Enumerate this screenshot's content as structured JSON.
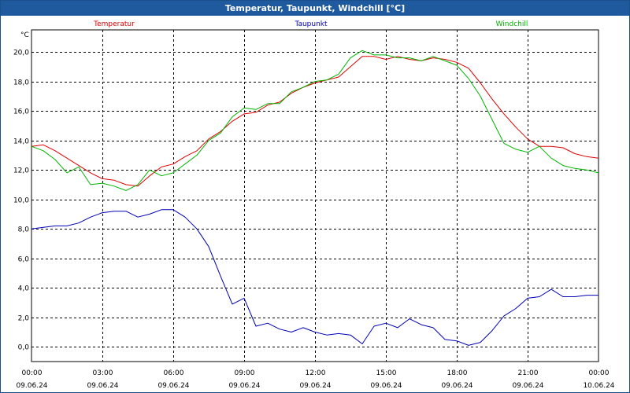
{
  "window": {
    "title": "Temperatur, Taupunkt, Windchill [°C]"
  },
  "chart_data": {
    "type": "line",
    "title": "Temperatur, Taupunkt, Windchill [°C]",
    "ylabel": "°C",
    "ylim": [
      -1,
      21.5
    ],
    "yticks": [
      "20,0",
      "18,0",
      "16,0",
      "14,0",
      "12,0",
      "10,0",
      "8,0",
      "6,0",
      "4,0",
      "2,0",
      "0,0"
    ],
    "ytick_values": [
      20,
      18,
      16,
      14,
      12,
      10,
      8,
      6,
      4,
      2,
      0
    ],
    "xlim_hours": [
      0,
      24
    ],
    "xticks": [
      {
        "time": "00:00",
        "date": "09.06.24"
      },
      {
        "time": "03:00",
        "date": "09.06.24"
      },
      {
        "time": "06:00",
        "date": "09.06.24"
      },
      {
        "time": "09:00",
        "date": "09.06.24"
      },
      {
        "time": "12:00",
        "date": "09.06.24"
      },
      {
        "time": "15:00",
        "date": "09.06.24"
      },
      {
        "time": "18:00",
        "date": "09.06.24"
      },
      {
        "time": "21:00",
        "date": "09.06.24"
      },
      {
        "time": "00:00",
        "date": "10.06.24"
      }
    ],
    "xtick_hours": [
      0,
      3,
      6,
      9,
      12,
      15,
      18,
      21,
      24
    ],
    "grid": true,
    "series": [
      {
        "name": "Temperatur",
        "color": "#e00000",
        "x": [
          0,
          0.5,
          1,
          1.5,
          2,
          2.5,
          3,
          3.5,
          4,
          4.5,
          5,
          5.5,
          6,
          6.5,
          7,
          7.5,
          8,
          8.5,
          9,
          9.5,
          10,
          10.5,
          11,
          11.5,
          12,
          12.5,
          13,
          13.5,
          14,
          14.5,
          15,
          15.5,
          16,
          16.5,
          17,
          17.5,
          18,
          18.5,
          19,
          19.5,
          20,
          20.5,
          21,
          21.5,
          22,
          22.5,
          23,
          23.5,
          24
        ],
        "y": [
          13.6,
          13.7,
          13.3,
          12.8,
          12.3,
          11.8,
          11.4,
          11.3,
          11.0,
          10.9,
          11.6,
          12.2,
          12.4,
          12.9,
          13.3,
          14.1,
          14.6,
          15.3,
          15.8,
          15.9,
          16.4,
          16.6,
          17.2,
          17.6,
          17.9,
          18.1,
          18.3,
          19.0,
          19.7,
          19.7,
          19.5,
          19.7,
          19.5,
          19.4,
          19.6,
          19.5,
          19.3,
          18.9,
          17.9,
          16.8,
          15.8,
          14.9,
          14.1,
          13.6,
          13.6,
          13.5,
          13.1,
          12.9,
          12.8
        ]
      },
      {
        "name": "Taupunkt",
        "color": "#0000b4",
        "x": [
          0,
          0.5,
          1,
          1.5,
          2,
          2.5,
          3,
          3.5,
          4,
          4.5,
          5,
          5.5,
          6,
          6.5,
          7,
          7.5,
          8,
          8.5,
          9,
          9.5,
          10,
          10.5,
          11,
          11.5,
          12,
          12.5,
          13,
          13.5,
          14,
          14.5,
          15,
          15.5,
          16,
          16.5,
          17,
          17.5,
          18,
          18.5,
          19,
          19.5,
          20,
          20.5,
          21,
          21.5,
          22,
          22.5,
          23,
          23.5,
          24
        ],
        "y": [
          8.0,
          8.1,
          8.2,
          8.2,
          8.4,
          8.8,
          9.1,
          9.2,
          9.2,
          8.8,
          9.0,
          9.3,
          9.3,
          8.8,
          8.0,
          6.8,
          4.8,
          2.9,
          3.3,
          1.4,
          1.6,
          1.2,
          1.0,
          1.3,
          1.0,
          0.8,
          0.9,
          0.8,
          0.2,
          1.4,
          1.6,
          1.3,
          1.9,
          1.5,
          1.3,
          0.5,
          0.4,
          0.1,
          0.3,
          1.1,
          2.1,
          2.6,
          3.3,
          3.4,
          3.9,
          3.4,
          3.4,
          3.5,
          3.5
        ]
      },
      {
        "name": "Windchill",
        "color": "#00b400",
        "x": [
          0,
          0.5,
          1,
          1.5,
          2,
          2.5,
          3,
          3.5,
          4,
          4.5,
          5,
          5.5,
          6,
          6.5,
          7,
          7.5,
          8,
          8.5,
          9,
          9.5,
          10,
          10.5,
          11,
          11.5,
          12,
          12.5,
          13,
          13.5,
          14,
          14.5,
          15,
          15.5,
          16,
          16.5,
          17,
          17.5,
          18,
          18.5,
          19,
          19.5,
          20,
          20.5,
          21,
          21.5,
          22,
          22.5,
          23,
          23.5,
          24
        ],
        "y": [
          13.6,
          13.3,
          12.7,
          11.8,
          12.2,
          11.0,
          11.1,
          10.9,
          10.6,
          11.0,
          12.0,
          11.6,
          11.8,
          12.4,
          13.0,
          14.0,
          14.5,
          15.6,
          16.2,
          16.1,
          16.5,
          16.5,
          17.3,
          17.6,
          18.0,
          18.1,
          18.5,
          19.6,
          20.1,
          19.8,
          19.8,
          19.6,
          19.6,
          19.4,
          19.7,
          19.4,
          19.1,
          18.2,
          17.0,
          15.4,
          13.8,
          13.4,
          13.2,
          13.6,
          12.8,
          12.3,
          12.1,
          12.0,
          11.8
        ]
      }
    ],
    "legend_placement": "top"
  }
}
